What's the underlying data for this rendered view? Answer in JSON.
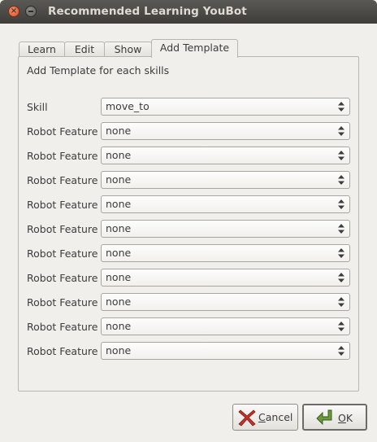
{
  "window": {
    "title": "Recommended Learning YouBot"
  },
  "tabs": [
    {
      "label": "Learn"
    },
    {
      "label": "Edit"
    },
    {
      "label": "Show"
    },
    {
      "label": "Add Template"
    }
  ],
  "panel": {
    "heading": "Add Template for each skills",
    "skill": {
      "label": "Skill",
      "value": "move_to"
    },
    "features": [
      {
        "label": "Robot Feature",
        "value": "none"
      },
      {
        "label": "Robot Feature",
        "value": "none"
      },
      {
        "label": "Robot Feature",
        "value": "none"
      },
      {
        "label": "Robot Feature",
        "value": "none"
      },
      {
        "label": "Robot Feature",
        "value": "none"
      },
      {
        "label": "Robot Feature",
        "value": "none"
      },
      {
        "label": "Robot Feature",
        "value": "none"
      },
      {
        "label": "Robot Feature",
        "value": "none"
      },
      {
        "label": "Robot Feature",
        "value": "none"
      },
      {
        "label": "Robot Feature",
        "value": "none"
      }
    ]
  },
  "buttons": {
    "cancel": {
      "mnemonic": "C",
      "rest": "ancel",
      "icon": "cancel-x-icon"
    },
    "ok": {
      "mnemonic": "O",
      "rest": "K",
      "icon": "ok-arrow-icon"
    }
  }
}
